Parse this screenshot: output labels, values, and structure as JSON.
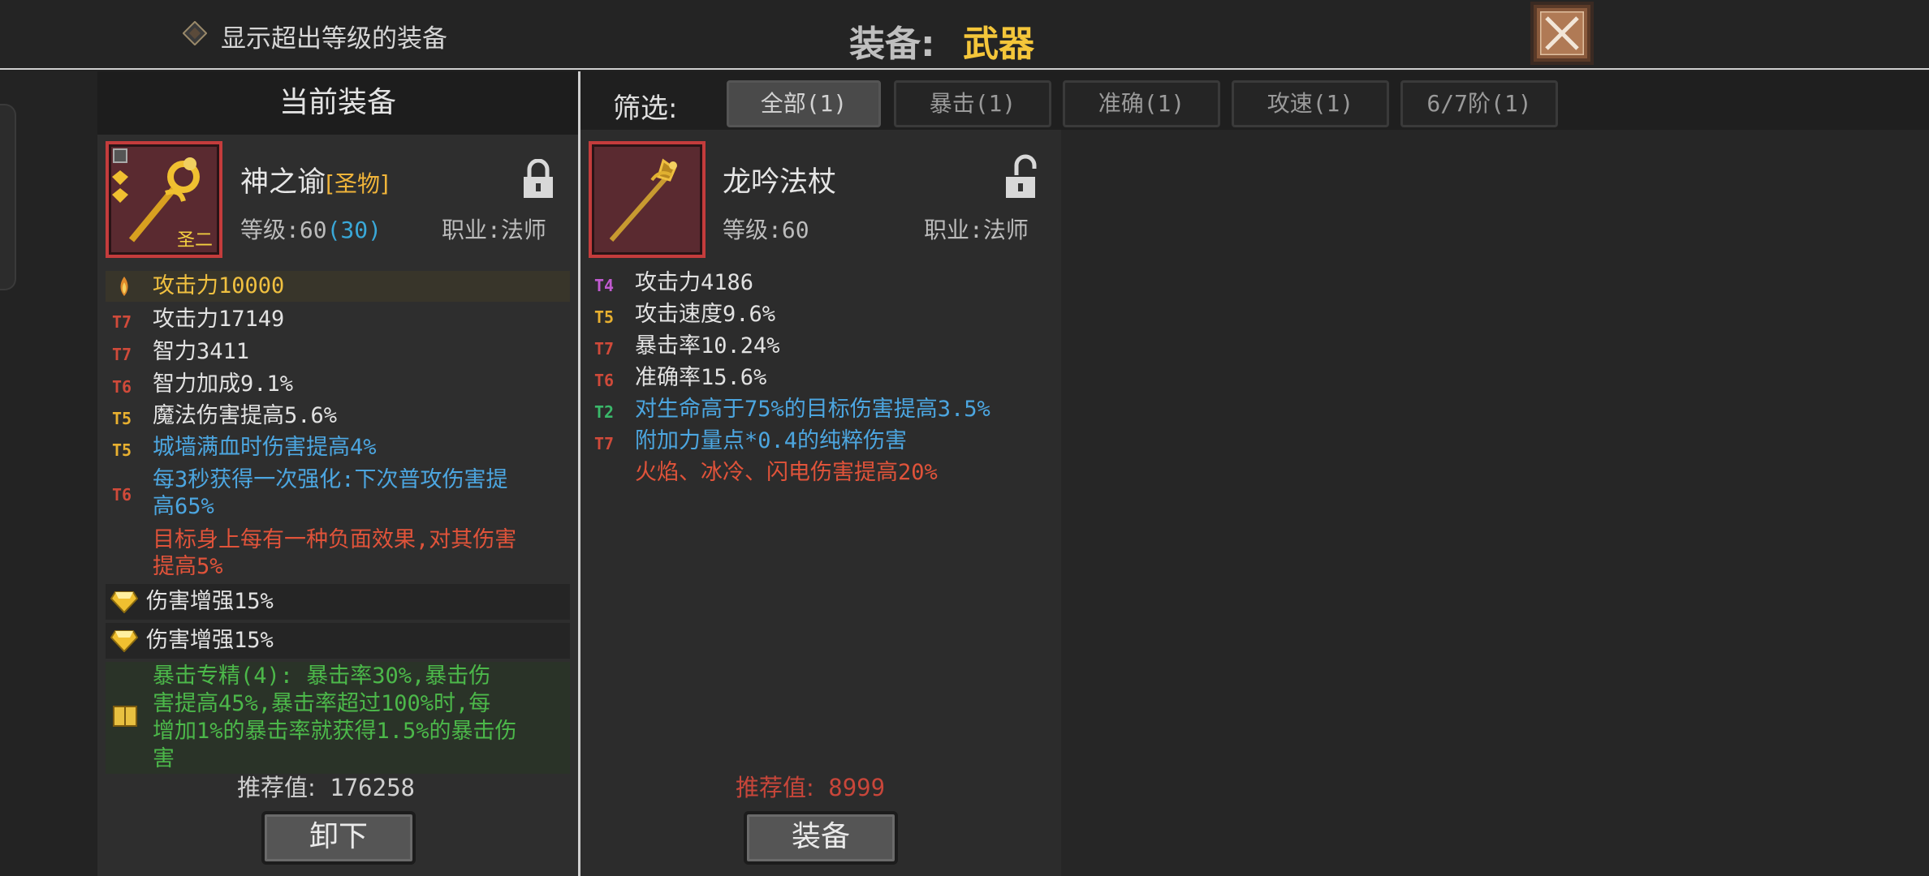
{
  "topbar": {
    "toggle_label": "显示超出等级的装备",
    "title_label": "装备:",
    "title_value": "武器"
  },
  "current": {
    "header": "当前装备",
    "name": "神之谕",
    "name_tag": "[圣物]",
    "badge": "圣二",
    "level_label": "等级:",
    "level_value": "60",
    "level_extra": "(30)",
    "class_text": "职业:法师",
    "base_stat": "攻击力10000",
    "stats": [
      {
        "tier": "T7",
        "text": "攻击力17149"
      },
      {
        "tier": "T7",
        "text": "智力3411"
      },
      {
        "tier": "T6",
        "text": "智力加成9.1%"
      },
      {
        "tier": "T5",
        "text": "魔法伤害提高5.6%"
      },
      {
        "tier": "T5",
        "text": "城墙满血时伤害提高4%"
      },
      {
        "tier": "T6",
        "text": "每3秒获得一次强化:下次普攻伤害提",
        "text2": "高65%"
      },
      {
        "tier": "",
        "text": "目标身上每有一种负面效果,对其伤害",
        "text2": "提高5%"
      }
    ],
    "gems": [
      "伤害增强15%",
      "伤害增强15%"
    ],
    "set_bonus": [
      "暴击专精(4): 暴击率30%,暴击伤",
      "害提高45%,暴击率超过100%时,每",
      "增加1%的暴击率就获得1.5%的暴击伤",
      "害"
    ],
    "score_label": "推荐值:",
    "score_value": "176258",
    "button": "卸下"
  },
  "filter": {
    "label": "筛选:",
    "tabs": [
      "全部(1)",
      "暴击(1)",
      "准确(1)",
      "攻速(1)",
      "6/7阶(1)"
    ]
  },
  "candidate": {
    "name": "龙吟法杖",
    "level_label": "等级:",
    "level_value": "60",
    "class_text": "职业:法师",
    "stats": [
      {
        "tier": "T4",
        "text": "攻击力4186"
      },
      {
        "tier": "T5",
        "text": "攻击速度9.6%"
      },
      {
        "tier": "T7",
        "text": "暴击率10.24%"
      },
      {
        "tier": "T6",
        "text": "准确率15.6%"
      },
      {
        "tier": "T2",
        "text": "对生命高于75%的目标伤害提高3.5%"
      },
      {
        "tier": "T7",
        "text": "附加力量点*0.4的纯粹伤害"
      },
      {
        "tier": "",
        "text": "火焰、冰冷、闪电伤害提高20%"
      }
    ],
    "score_label": "推荐值:",
    "score_value": "8999",
    "button": "装备"
  },
  "colors": {
    "gold": "#f4c63a",
    "rarity_red": "#c43c3c",
    "tier_red": "#d04a3a",
    "tier_yellow": "#e8b030",
    "tier_purple": "#c05ad0",
    "tier_green": "#3ab86a",
    "affix_blue": "#4ca6e0",
    "affix_red": "#e0533a",
    "set_green": "#4cb84a"
  },
  "icons": [
    "diamond-toggle-icon",
    "close-x-icon",
    "lock-closed-icon",
    "lock-open-icon",
    "staff-icon",
    "gem-icon",
    "book-icon",
    "flame-icon"
  ]
}
